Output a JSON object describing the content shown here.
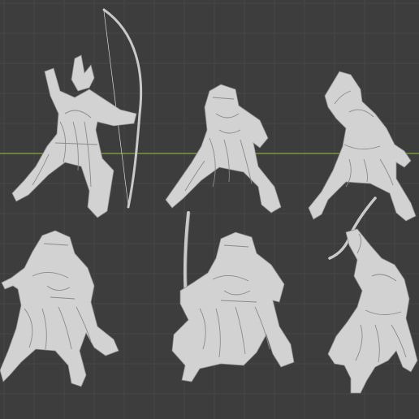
{
  "viewport": {
    "background_color": "#3d3d3d",
    "grid_color": "#474747",
    "x_axis_color": "#7b9a3f",
    "miniature_color": "#d2d2d2",
    "origin_marker_color": "#e08a1e"
  },
  "miniatures": [
    {
      "pose": "archer-drawing-bow"
    },
    {
      "pose": "hooded-standing"
    },
    {
      "pose": "arm-raised-reaching"
    },
    {
      "pose": "hooded-cloak-left"
    },
    {
      "pose": "hooded-with-blade"
    },
    {
      "pose": "raised-curved-sword"
    }
  ]
}
